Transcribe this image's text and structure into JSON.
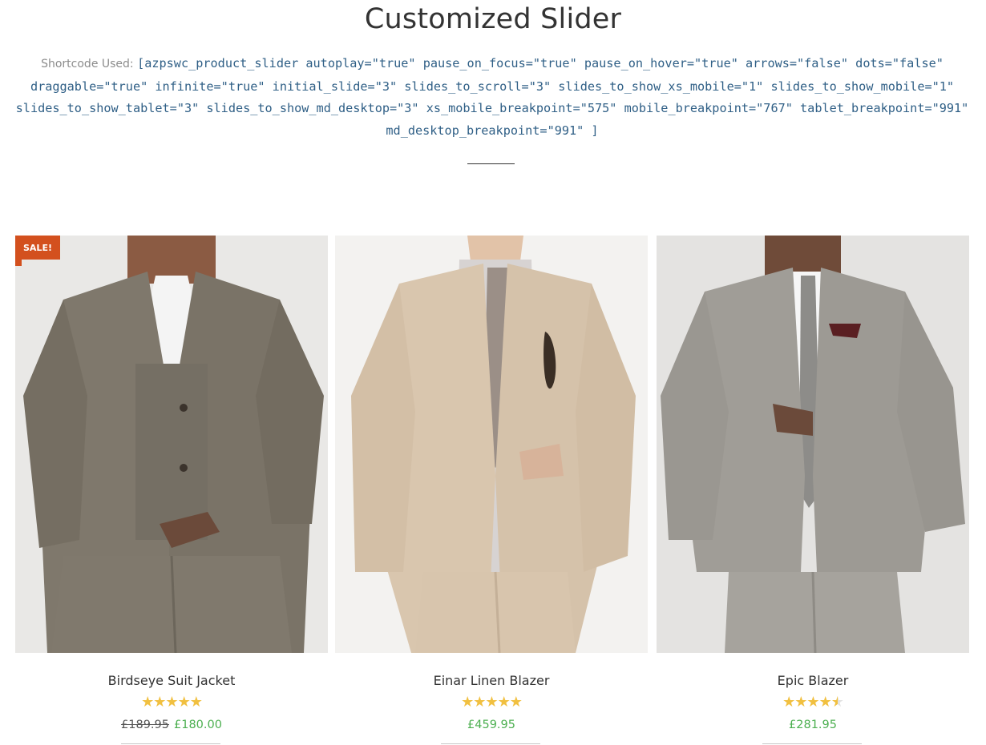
{
  "page": {
    "title": "Customized Slider",
    "shortcode_label": "Shortcode Used:",
    "shortcode": "[azpswc_product_slider autoplay=\"true\" pause_on_focus=\"true\" pause_on_hover=\"true\" arrows=\"false\" dots=\"false\" draggable=\"true\" infinite=\"true\" initial_slide=\"3\" slides_to_scroll=\"3\" slides_to_show_xs_mobile=\"1\" slides_to_show_mobile=\"1\" slides_to_show_tablet=\"3\" slides_to_show_md_desktop=\"3\" xs_mobile_breakpoint=\"575\" mobile_breakpoint=\"767\" tablet_breakpoint=\"991\" md_desktop_breakpoint=\"991\" ]"
  },
  "colors": {
    "accent_sale": "#d3501e",
    "price_green": "#4caf50",
    "star_gold": "#f1c040",
    "code_blue": "#2f5f86"
  },
  "products": [
    {
      "name": "Birdseye Suit Jacket",
      "badge": "SALE!",
      "rating": 5,
      "old_price": "£189.95",
      "price": "£180.00"
    },
    {
      "name": "Einar Linen Blazer",
      "rating": 5,
      "price": "£459.95"
    },
    {
      "name": "Epic Blazer",
      "rating": 4.5,
      "price": "£281.95"
    }
  ]
}
